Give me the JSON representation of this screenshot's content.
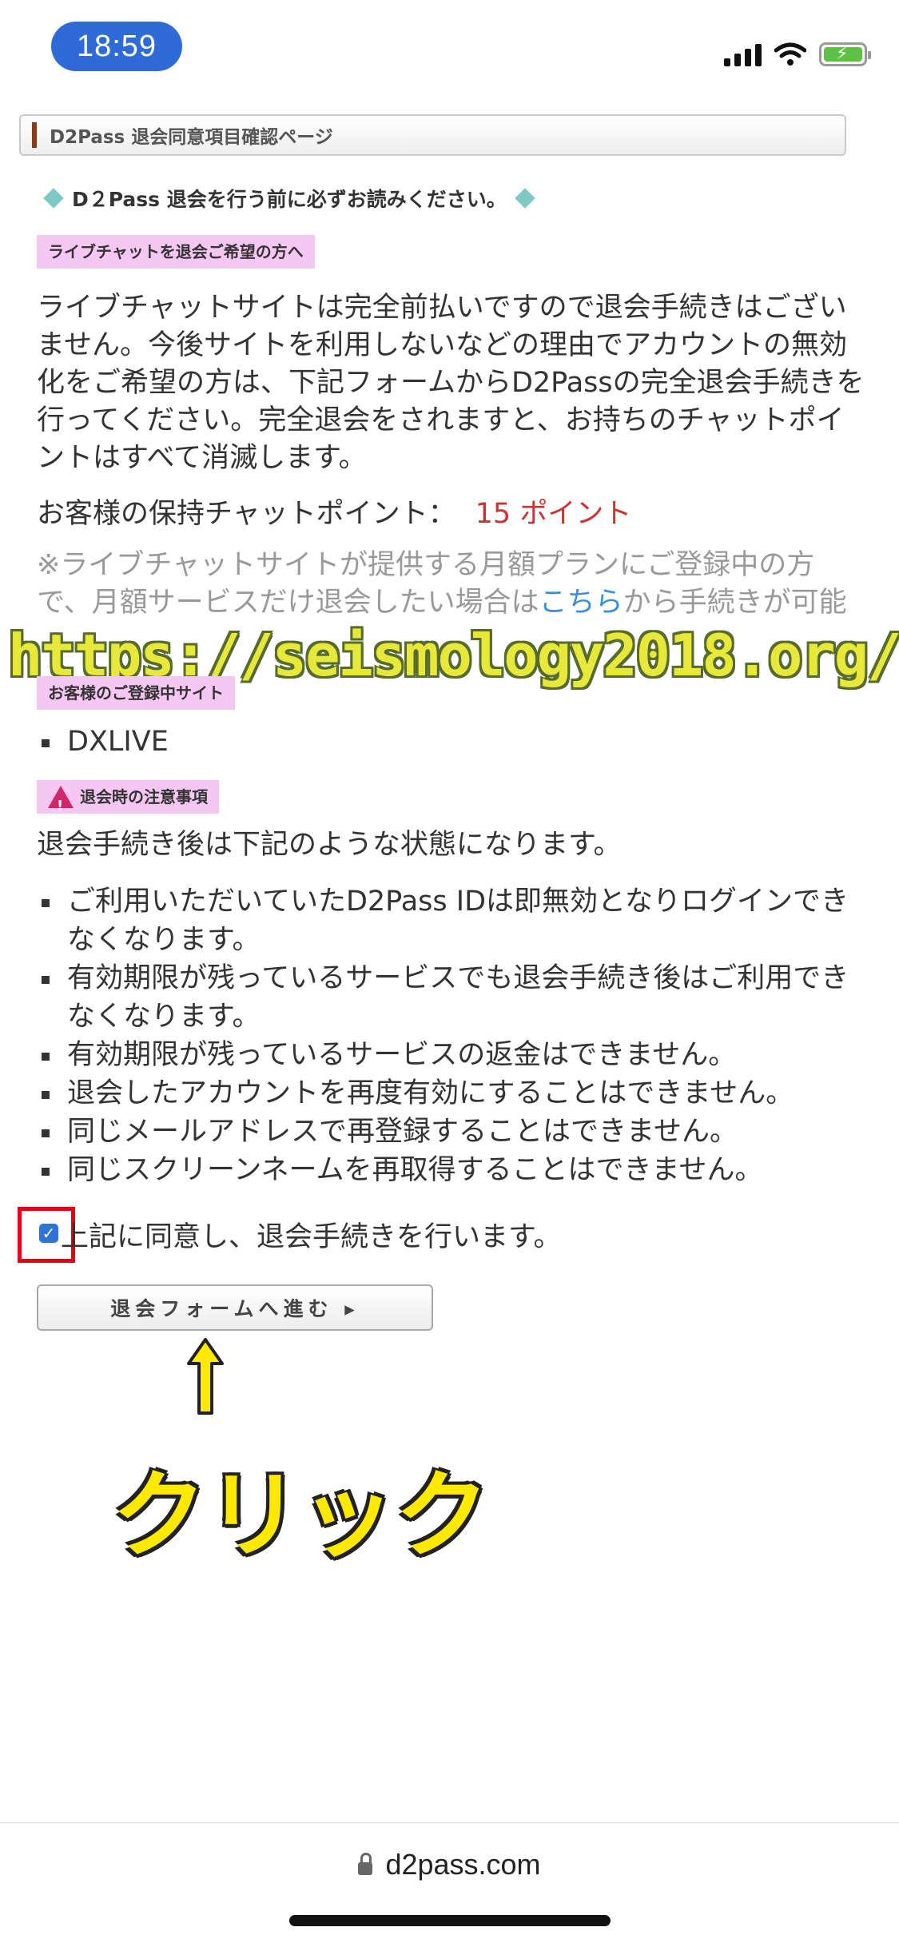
{
  "status_bar": {
    "time": "18:59"
  },
  "header": {
    "title": "D2Pass 退会同意項目確認ページ"
  },
  "notice": "D２Pass 退会を行う前に必ずお読みください。",
  "livechat_section": {
    "label": "ライブチャットを退会ご希望の方へ",
    "body": "ライブチャットサイトは完全前払いですので退会手続きはございません。今後サイトを利用しないなどの理由でアカウントの無効化をご希望の方は、下記フォームからD2Passの完全退会手続きを行ってください。完全退会をされますと、お持ちのチャットポイントはすべて消滅します。",
    "points_label": "お客様の保持チャットポイント：",
    "points_value": "15 ポイント",
    "note_before_link": "※ライブチャットサイトが提供する月額プランにご登録中の方で、月額サービスだけ退会したい場合は",
    "note_link": "こちら",
    "note_after_link": "から手続きが可能です。"
  },
  "watermark": "https://seismology2018.org/",
  "registered_section": {
    "label": "お客様のご登録中サイト",
    "sites": [
      "DXLIVE"
    ]
  },
  "caution_section": {
    "label": "退会時の注意事項",
    "intro": "退会手続き後は下記のような状態になります。",
    "items": [
      "ご利用いただいていたD2Pass IDは即無効となりログインできなくなります。",
      "有効期限が残っているサービスでも退会手続き後はご利用できなくなります。",
      "有効期限が残っているサービスの返金はできません。",
      "退会したアカウントを再度有効にすることはできません。",
      "同じメールアドレスで再登録することはできません。",
      "同じスクリーンネームを再取得することはできません。"
    ]
  },
  "agree": {
    "label": "上記に同意し、退会手続きを行います。",
    "checked": true
  },
  "form_button": {
    "label": "退会フォームへ進む ▸"
  },
  "annotation": {
    "click_text": "クリック"
  },
  "browser": {
    "url": "d2pass.com"
  },
  "colors": {
    "accent_blue": "#2f6bd8",
    "points_red": "#cc3333",
    "pink_label": "#f6c7f3",
    "highlight_red": "#e60012",
    "annotation_yellow": "#ffe900"
  }
}
